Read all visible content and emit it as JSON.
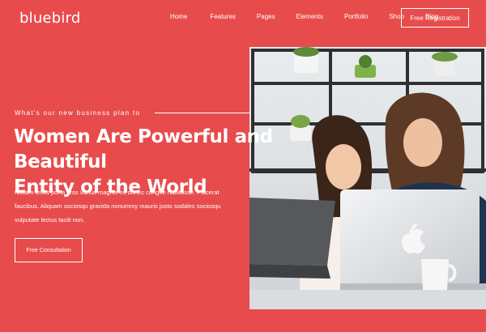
{
  "brand": {
    "logo_text": "bluebird"
  },
  "nav": {
    "items": [
      "Home",
      "Features",
      "Pages",
      "Elements",
      "Portfolio",
      "Shop",
      "Blog"
    ],
    "cta_label": "Free Registration"
  },
  "hero": {
    "eyebrow": "What's our new business plan to",
    "headline_line1": "Women Are Powerful and Beautiful",
    "headline_line2": "Entity of the World",
    "body_line1": "Nullam tellus porta eros varius magnis eu donec congue habitasse. Placerat",
    "body_line2": "faucibus. Aliquam sociosqu gravida nonummy mauris justo sodales sociosqu",
    "body_line3": "vulputate lectus taciti non.",
    "cta_label": "Free Consultation"
  },
  "colors": {
    "background": "#e84b4b",
    "text": "#ffffff"
  }
}
